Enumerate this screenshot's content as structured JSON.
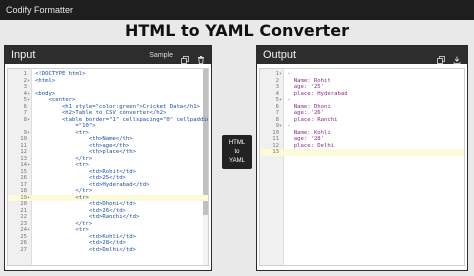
{
  "app": {
    "title": "Codify Formatter"
  },
  "page": {
    "title": "HTML to YAML Converter"
  },
  "input_panel": {
    "title": "Input",
    "sample_label": "Sample",
    "lines": [
      "<!DOCTYPE html>",
      "<html>",
      "",
      "<body>",
      "    <center>",
      "        <h1 style=\"color:green\">Cricket Data</h1>",
      "        <h2>Table to CSV converter</h2>",
      "        <table border=\"1\" cellspacing=\"0\" cellpadding",
      "            =\"10\">",
      "            <tr>",
      "                <th>Name</th>",
      "                <th>age</th>",
      "                <th>place</th>",
      "            </tr>",
      "            <tr>",
      "                <td>Rohit</td>",
      "                <td>25</td>",
      "                <td>Hyderabad</td>",
      "            </tr>",
      "            <tr>",
      "                <td>Dhoni</td>",
      "                <td>26</td>",
      "                <td>Ranchi</td>",
      "            </tr>",
      "            <tr>",
      "                <td>Kohli</td>",
      "                <td>28</td>",
      "                <td>Delhi</td>"
    ],
    "line_numbers": [
      "1",
      "2",
      "3",
      "4",
      "5",
      "6",
      "7",
      "8",
      "",
      "9",
      "10",
      "11",
      "12",
      "13",
      "14",
      "15",
      "16",
      "17",
      "18",
      "19",
      "20",
      "21",
      "22",
      "23",
      "24",
      "25",
      "26",
      "27"
    ],
    "active_line_index": 19
  },
  "convert_button": {
    "line1": "HTML",
    "line2": "to",
    "line3": "YAML"
  },
  "output_panel": {
    "title": "Output",
    "lines": [
      "-",
      "  Name: Rohit",
      "  age: '25'",
      "  place: Hyderabad",
      "-",
      "  Name: Dhoni",
      "  age: '26'",
      "  place: Ranchi",
      "-",
      "  Name: Kohli",
      "  age: '28'",
      "  place: Delhi",
      ""
    ],
    "line_numbers": [
      "1",
      "2",
      "3",
      "4",
      "5",
      "6",
      "7",
      "8",
      "9",
      "10",
      "11",
      "12",
      "13"
    ],
    "active_line_index": 12
  },
  "colors": {
    "navbar": "#1e1e1e",
    "panel_header": "#2d2d2d",
    "active_line": "#fdfad9",
    "tag": "#1a4fa3"
  }
}
